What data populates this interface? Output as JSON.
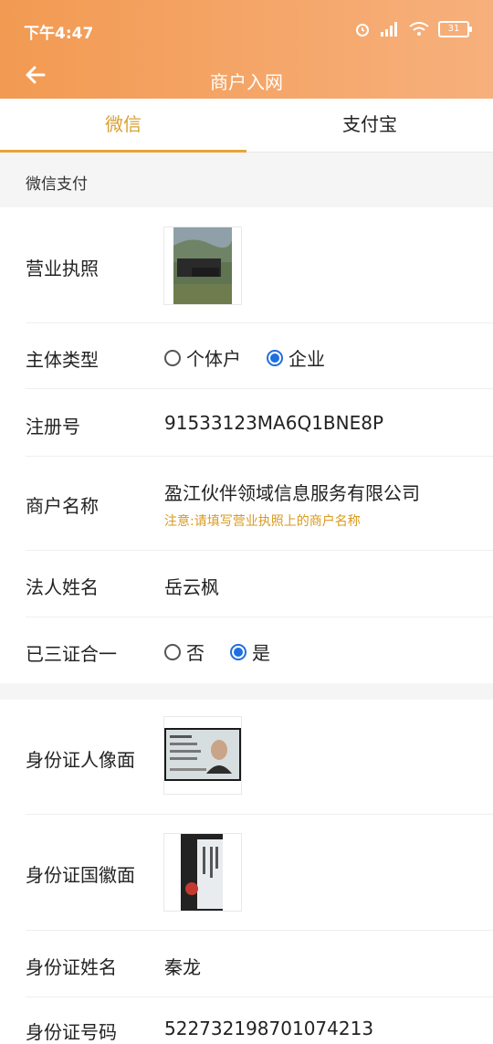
{
  "status": {
    "time": "下午4:47",
    "battery": "31"
  },
  "nav": {
    "title": "商户入网"
  },
  "tabs": [
    {
      "label": "微信"
    },
    {
      "label": "支付宝"
    }
  ],
  "section": {
    "title": "微信支付"
  },
  "form": {
    "license": {
      "label": "营业执照"
    },
    "entity_type": {
      "label": "主体类型",
      "options": [
        "个体户",
        "企业"
      ],
      "selected": "企业"
    },
    "reg_no": {
      "label": "注册号",
      "value": "91533123MA6Q1BNE8P"
    },
    "merchant_name": {
      "label": "商户名称",
      "value": "盈江伙伴领域信息服务有限公司",
      "hint": "注意:请填写营业执照上的商户名称"
    },
    "legal_name": {
      "label": "法人姓名",
      "value": "岳云枫"
    },
    "three_in_one": {
      "label": "已三证合一",
      "options": [
        "否",
        "是"
      ],
      "selected": "是"
    },
    "id_front": {
      "label": "身份证人像面"
    },
    "id_back": {
      "label": "身份证国徽面"
    },
    "id_name": {
      "label": "身份证姓名",
      "value": "秦龙"
    },
    "id_number": {
      "label": "身份证号码",
      "value": "522732198701074213"
    }
  },
  "colors": {
    "header_start": "#f29a52",
    "header_end": "#f7b07c",
    "accent": "#d9a032",
    "radio": "#1e6fe0",
    "hint": "#d99a1e"
  }
}
